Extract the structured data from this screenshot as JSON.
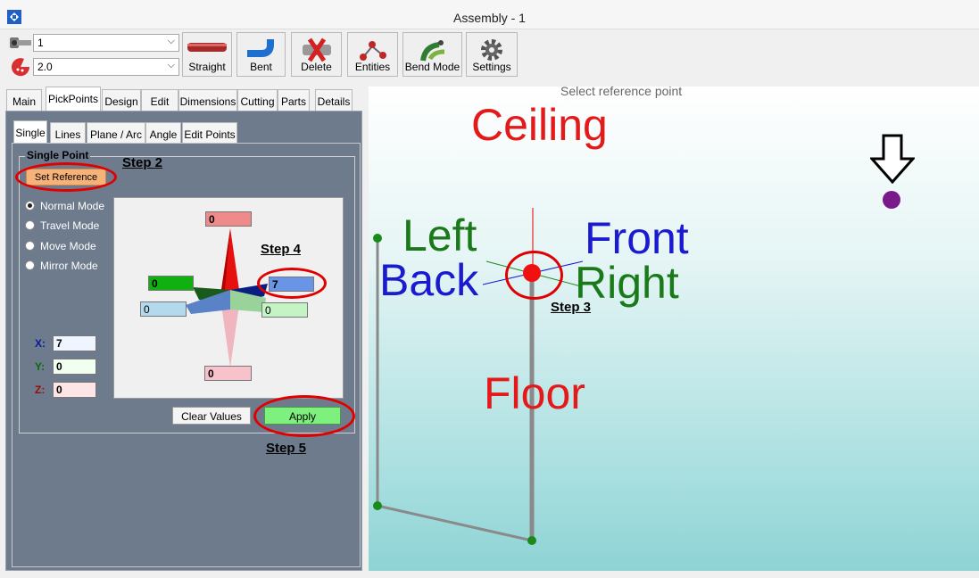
{
  "window": {
    "title": "Assembly - 1"
  },
  "toolbar": {
    "combo1": {
      "value": "1",
      "icon": "pipe-icon"
    },
    "combo2": {
      "value": "2.0",
      "icon": "pie-icon"
    },
    "buttons": [
      {
        "label": "Straight",
        "icon": "straight-pipe-icon"
      },
      {
        "label": "Bent",
        "icon": "bent-pipe-icon"
      },
      {
        "label": "Delete",
        "icon": "delete-icon"
      },
      {
        "label": "Entities",
        "icon": "entities-icon"
      },
      {
        "label": "Bend Mode",
        "icon": "bend-mode-icon"
      },
      {
        "label": "Settings",
        "icon": "gear-icon"
      }
    ]
  },
  "tabs": [
    "Main",
    "PickPoints",
    "Design",
    "Edit",
    "Dimensions",
    "Cutting",
    "Parts",
    "Details"
  ],
  "subtabs": [
    "Single",
    "Lines",
    "Plane / Arc",
    "Angle",
    "Edit Points"
  ],
  "panel": {
    "group_title": "Single Point",
    "set_reference": "Set Reference",
    "modes": [
      "Normal Mode",
      "Travel Mode",
      "Move Mode",
      "Mirror Mode"
    ],
    "selected_mode": "Normal Mode",
    "widget": {
      "top": "0",
      "left": "0",
      "right": "7",
      "back": "0",
      "front": "0",
      "bottom": "0"
    },
    "coords": {
      "x_label": "X:",
      "x": "7",
      "y_label": "Y:",
      "y": "0",
      "z_label": "Z:",
      "z": "0"
    },
    "clear_values": "Clear Values",
    "apply": "Apply"
  },
  "annotations": {
    "step2": "Step 2",
    "step3": "Step 3",
    "step4": "Step 4",
    "step5": "Step 5"
  },
  "viewport": {
    "prompt": "Select reference point",
    "ceiling": "Ceiling",
    "floor": "Floor",
    "left": "Left",
    "back": "Back",
    "front": "Front",
    "right": "Right"
  },
  "colors": {
    "ceiling": "#e41a1a",
    "floor": "#e41a1a",
    "left": "#1a7a1a",
    "back": "#1a1ad0",
    "front": "#1a1ad0",
    "right": "#1a7a1a",
    "panel": "#6d7b8d",
    "ring": "#e00000"
  }
}
